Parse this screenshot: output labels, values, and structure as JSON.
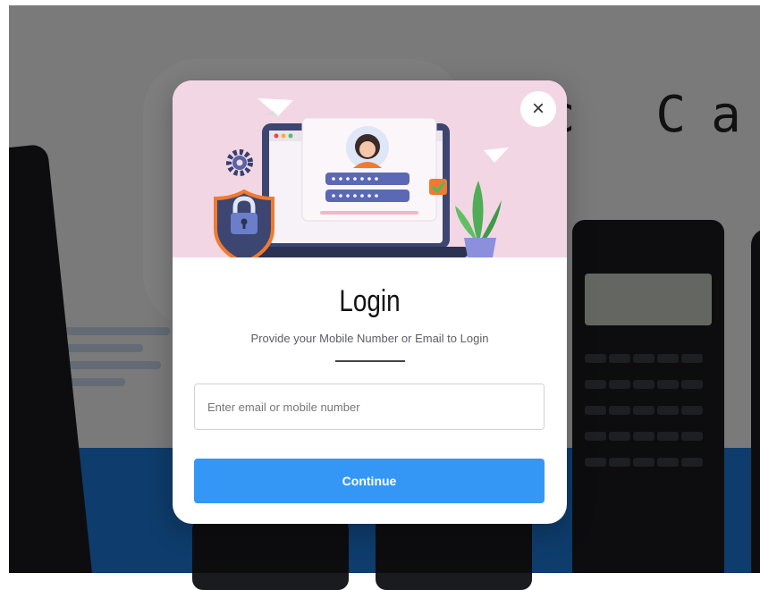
{
  "background": {
    "heading_fragment": "c Cal"
  },
  "modal": {
    "close_symbol": "×",
    "title": "Login",
    "subtitle": "Provide your Mobile Number or Email to Login",
    "input": {
      "value": "",
      "placeholder": "Enter email or mobile number"
    },
    "continue_label": "Continue"
  },
  "colors": {
    "hero_background": "#f3d6e4",
    "primary_button": "#3597f5",
    "background_band": "#1d78d8"
  },
  "icons": [
    "close-icon",
    "login-illustration",
    "paper-plane-icon",
    "gear-icon",
    "padlock-shield-icon",
    "avatar-icon",
    "checkbox-icon",
    "plant-icon"
  ]
}
